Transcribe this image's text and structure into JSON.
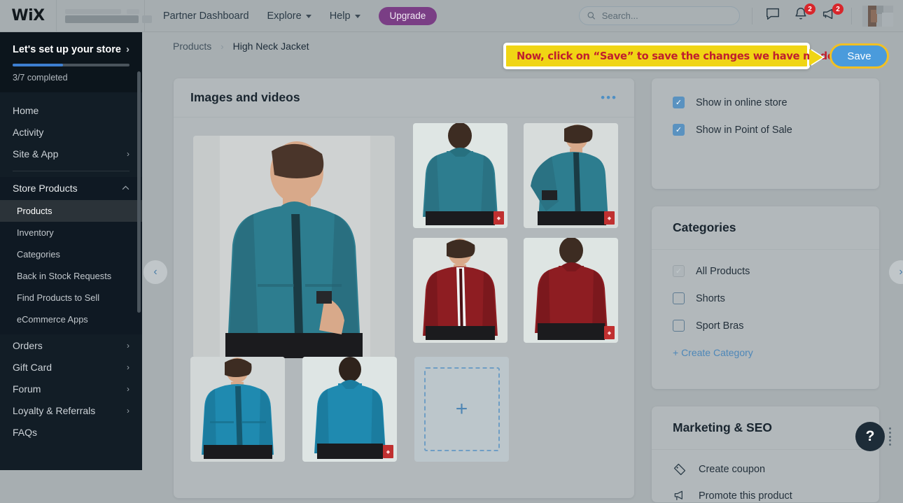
{
  "topbar": {
    "logo": "WiX",
    "site_name_blurred": "",
    "links": [
      {
        "label": "Partner Dashboard",
        "has_caret": false
      },
      {
        "label": "Explore",
        "has_caret": true
      },
      {
        "label": "Help",
        "has_caret": true
      }
    ],
    "upgrade_label": "Upgrade",
    "search_placeholder": "Search...",
    "search_value": "",
    "notifications_badge": "2",
    "announcements_badge": "2"
  },
  "sidebar": {
    "setup": {
      "title": "Let's set up your store",
      "progress_label": "3/7 completed",
      "progress_percent": 43
    },
    "items": [
      {
        "label": "Home",
        "type": "top",
        "chevron": ""
      },
      {
        "label": "Activity",
        "type": "top",
        "chevron": ""
      },
      {
        "label": "Site & App",
        "type": "top",
        "chevron": "›"
      },
      {
        "label": "Store Products",
        "type": "group",
        "chevron": "⌃"
      },
      {
        "label": "Products",
        "type": "sub",
        "active": true
      },
      {
        "label": "Inventory",
        "type": "sub"
      },
      {
        "label": "Categories",
        "type": "sub"
      },
      {
        "label": "Back in Stock Requests",
        "type": "sub"
      },
      {
        "label": "Find Products to Sell",
        "type": "sub"
      },
      {
        "label": "eCommerce Apps",
        "type": "sub"
      },
      {
        "label": "Orders",
        "type": "top",
        "chevron": "›"
      },
      {
        "label": "Gift Card",
        "type": "top",
        "chevron": "›"
      },
      {
        "label": "Forum",
        "type": "top",
        "chevron": "›"
      },
      {
        "label": "Loyalty & Referrals",
        "type": "top",
        "chevron": "›"
      },
      {
        "label": "FAQs",
        "type": "top",
        "chevron": ""
      }
    ]
  },
  "breadcrumb": {
    "parent": "Products",
    "separator": "›",
    "current": "High Neck Jacket"
  },
  "callout": {
    "text": "Now, click on “Save” to save the changes we have made",
    "bg_color": "#f0d514",
    "text_color": "#c01f2e"
  },
  "save_button": {
    "label": "Save",
    "bg_color": "#4a9bdc",
    "ring_color": "#f2c023"
  },
  "images_panel": {
    "title": "Images and videos",
    "menu_icon": "•••",
    "add_tile_label": "+",
    "tiles": [
      {
        "name": "teal-jacket-front-large",
        "badge": false
      },
      {
        "name": "teal-jacket-back",
        "badge": true
      },
      {
        "name": "teal-jacket-side-pocket",
        "badge": true
      },
      {
        "name": "red-jacket-front",
        "badge": false
      },
      {
        "name": "red-jacket-back",
        "badge": true
      },
      {
        "name": "blue-jacket-front",
        "badge": false
      },
      {
        "name": "blue-jacket-back",
        "badge": true
      }
    ]
  },
  "visibility": {
    "options": [
      {
        "label": "Show in online store",
        "checked": true
      },
      {
        "label": "Show in Point of Sale",
        "checked": true
      }
    ]
  },
  "categories": {
    "title": "Categories",
    "items": [
      {
        "label": "All Products",
        "checked": true,
        "disabled": true
      },
      {
        "label": "Shorts",
        "checked": false,
        "disabled": false
      },
      {
        "label": "Sport Bras",
        "checked": false,
        "disabled": false
      }
    ],
    "create_link": "+ Create Category"
  },
  "marketing": {
    "title": "Marketing & SEO",
    "items": [
      {
        "label": "Create coupon",
        "icon": "coupon-icon"
      },
      {
        "label": "Promote this product",
        "icon": "megaphone-icon"
      }
    ]
  },
  "carousel": {
    "left_icon": "‹",
    "right_icon": "›"
  },
  "help": {
    "icon": "?"
  }
}
